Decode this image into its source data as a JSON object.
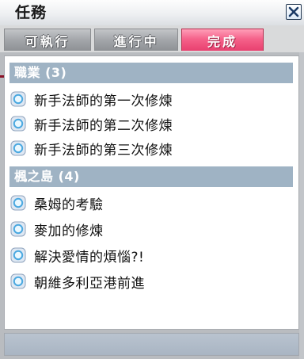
{
  "window": {
    "title": "任務"
  },
  "tabs": [
    {
      "label": "可執行",
      "active": false
    },
    {
      "label": "進行中",
      "active": false
    },
    {
      "label": "完成",
      "active": true
    }
  ],
  "sections": [
    {
      "header": "職業 (3)",
      "items": [
        {
          "label": "新手法師的第一次修煉"
        },
        {
          "label": "新手法師的第二次修煉"
        },
        {
          "label": "新手法師的第三次修煉"
        }
      ]
    },
    {
      "header": "楓之島 (4)",
      "items": [
        {
          "label": "桑姆的考驗"
        },
        {
          "label": "麥加的修煉"
        },
        {
          "label": "解決愛情的煩惱?!"
        },
        {
          "label": "朝維多利亞港前進"
        }
      ]
    }
  ],
  "icons": {
    "close": "close-icon",
    "quest_bullet": "quest-bullet-icon"
  },
  "colors": {
    "active_tab": "#f5628a",
    "section_header": "#9fb3c4",
    "tab_underline": "#8a1126"
  }
}
